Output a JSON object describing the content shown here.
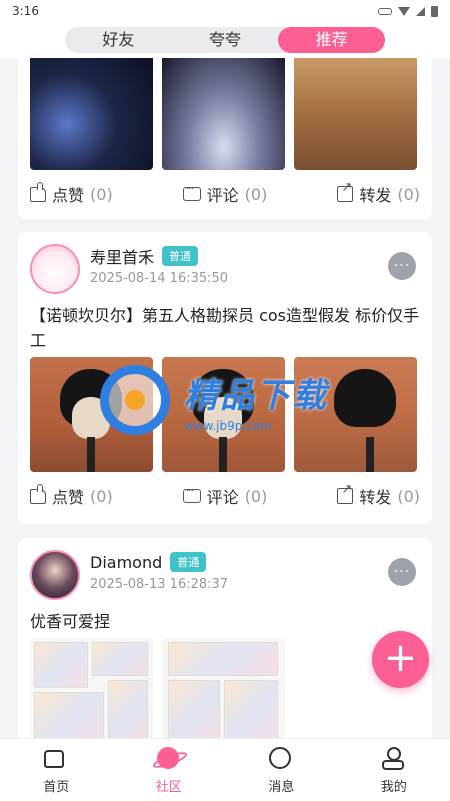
{
  "status_bar": {
    "time": "3:16"
  },
  "top_tabs": [
    {
      "label": "好友",
      "active": false
    },
    {
      "label": "夸夸",
      "active": false
    },
    {
      "label": "推荐",
      "active": true
    }
  ],
  "posts": [
    {
      "photos": [
        "cos-photo-1",
        "cos-photo-2",
        "cos-photo-3"
      ],
      "actions": {
        "like_label": "点赞",
        "like_count": "(0)",
        "comment_label": "评论",
        "comment_count": "(0)",
        "share_label": "转发",
        "share_count": "(0)"
      }
    },
    {
      "username": "寿里首禾",
      "badge": "普通",
      "date": "2025-08-14 16:35:50",
      "text": "【诺顿坎贝尔】第五人格勘探员 cos造型假发 标价仅手工",
      "actions": {
        "like_label": "点赞",
        "like_count": "(0)",
        "comment_label": "评论",
        "comment_count": "(0)",
        "share_label": "转发",
        "share_count": "(0)"
      }
    },
    {
      "username": "Diamond",
      "badge": "普通",
      "date": "2025-08-13 16:28:37",
      "text": "优香可爱捏"
    }
  ],
  "more_icon": "···",
  "fab_icon": "+",
  "watermark": {
    "title": "精品下载",
    "url": "www.jb9p.com"
  },
  "bottom_tabs": [
    {
      "label": "首页",
      "icon": "home-icon",
      "active": false
    },
    {
      "label": "社区",
      "icon": "planet-icon",
      "active": true
    },
    {
      "label": "消息",
      "icon": "message-icon",
      "active": false
    },
    {
      "label": "我的",
      "icon": "profile-icon",
      "active": false
    }
  ],
  "colors": {
    "accent": "#fb5f94",
    "badge": "#3fc3c9"
  }
}
